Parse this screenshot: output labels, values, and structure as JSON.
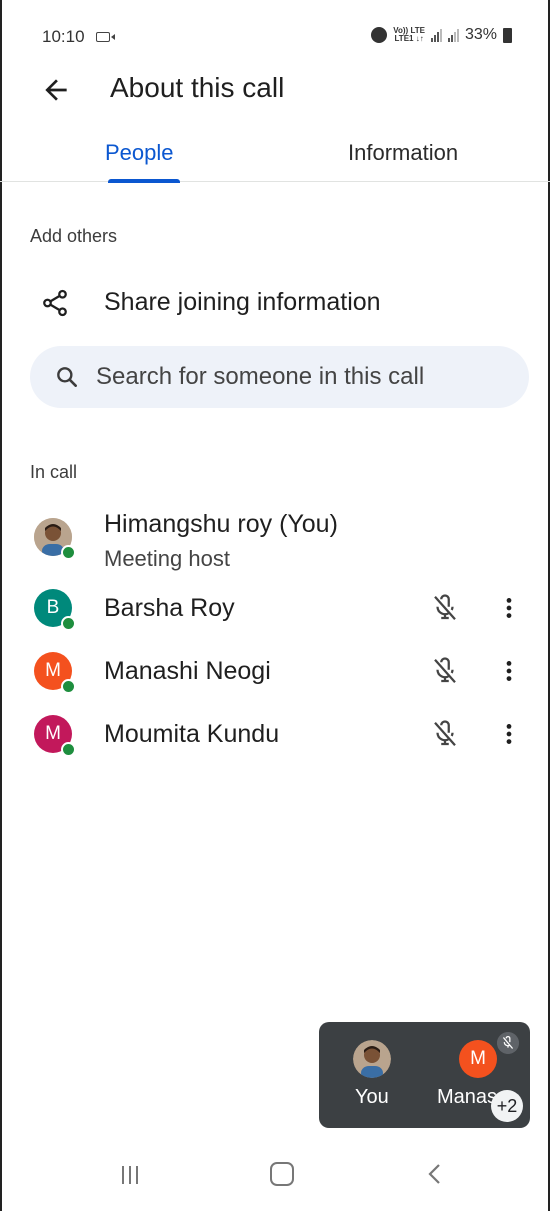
{
  "status_bar": {
    "time": "10:10",
    "net_label_top": "Vo)) LTE",
    "net_label_bottom": "LTE1 ↓↑",
    "battery": "33%"
  },
  "header": {
    "title": "About this call",
    "back_icon": "arrow-back-icon"
  },
  "tabs": [
    {
      "label": "People",
      "selected": true
    },
    {
      "label": "Information",
      "selected": false
    }
  ],
  "add_others": {
    "label": "Add others",
    "share_label": "Share joining information",
    "search_placeholder": "Search for someone in this call"
  },
  "in_call": {
    "label": "In call",
    "participants": [
      {
        "name": "Himangshu roy (You)",
        "subtitle": "Meeting host",
        "initial": "",
        "avatar_type": "photo",
        "color": "#8a6f5a"
      },
      {
        "name": "Barsha Roy",
        "initial": "B",
        "avatar_type": "initial",
        "color": "#00897b",
        "muted": true
      },
      {
        "name": "Manashi Neogi",
        "initial": "M",
        "avatar_type": "initial",
        "color": "#f4511e",
        "muted": true
      },
      {
        "name": "Moumita Kundu",
        "initial": "M",
        "avatar_type": "initial",
        "color": "#c2185b",
        "muted": true
      }
    ]
  },
  "floating_view": {
    "tiles": [
      {
        "label": "You"
      },
      {
        "label": "Manas",
        "initial": "M",
        "color": "#f4511e"
      }
    ],
    "more_count": "+2"
  },
  "colors": {
    "accent": "#0b57d0",
    "online": "#1e8e3e",
    "search_bg": "#eef2f9",
    "float_bg": "#3c4043"
  }
}
